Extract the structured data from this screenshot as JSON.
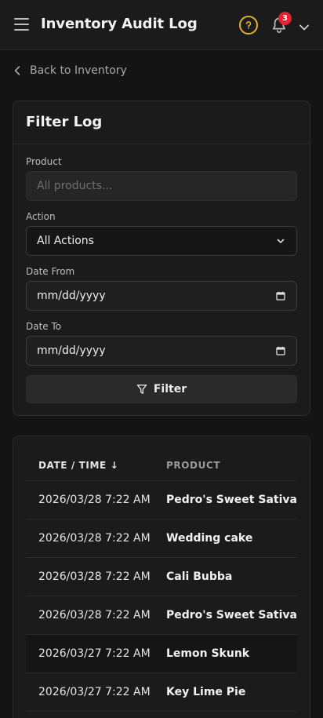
{
  "header": {
    "title": "Inventory Audit Log",
    "notification_count": "3",
    "icons": [
      "menu-icon",
      "help-icon",
      "bell-icon",
      "chevron-down-icon"
    ],
    "help_color": "#e2b02a",
    "badge_color": "#e5222d"
  },
  "nav": {
    "back_label": "Back to Inventory"
  },
  "filter": {
    "title": "Filter Log",
    "product_label": "Product",
    "product_placeholder": "All products...",
    "action_label": "Action",
    "action_value": "All Actions",
    "date_from_label": "Date From",
    "date_from_value": "mm/dd/yyyy",
    "date_to_label": "Date To",
    "date_to_value": "mm/dd/yyyy",
    "button_label": "Filter"
  },
  "table": {
    "columns": [
      "DATE / TIME ↓",
      "PRODUCT"
    ],
    "rows": [
      {
        "datetime": "2026/03/28 7:22 AM",
        "product": "Pedro's Sweet Sativa"
      },
      {
        "datetime": "2026/03/28 7:22 AM",
        "product": "Wedding cake"
      },
      {
        "datetime": "2026/03/28 7:22 AM",
        "product": "Cali Bubba"
      },
      {
        "datetime": "2026/03/28 7:22 AM",
        "product": "Pedro's Sweet Sativa"
      },
      {
        "datetime": "2026/03/27 7:22 AM",
        "product": "Lemon Skunk"
      },
      {
        "datetime": "2026/03/27 7:22 AM",
        "product": "Key Lime Pie"
      }
    ]
  }
}
